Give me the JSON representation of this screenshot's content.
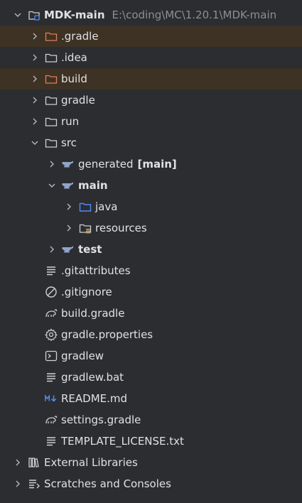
{
  "project": {
    "name": "MDK-main",
    "path": "E:\\coding\\MC\\1.20.1\\MDK-main"
  },
  "items": {
    "gradle_hidden": ".gradle",
    "idea": ".idea",
    "build": "build",
    "gradle": "gradle",
    "run": "run",
    "src": "src",
    "generated": "generated",
    "generated_suffix": "[main]",
    "main": "main",
    "java": "java",
    "resources": "resources",
    "test": "test",
    "gitattributes": ".gitattributes",
    "gitignore": ".gitignore",
    "build_gradle": "build.gradle",
    "gradle_properties": "gradle.properties",
    "gradlew": "gradlew",
    "gradlew_bat": "gradlew.bat",
    "readme": "README.md",
    "settings_gradle": "settings.gradle",
    "template_license": "TEMPLATE_LICENSE.txt",
    "external_libraries": "External Libraries",
    "scratches": "Scratches and Consoles"
  },
  "colors": {
    "background": "#2b2d30",
    "excluded_highlight": "#3d3223",
    "excluded_folder": "#e0805a",
    "source_folder": "#548af7",
    "text": "#dfe1e5",
    "path_text": "#8c8f94"
  }
}
